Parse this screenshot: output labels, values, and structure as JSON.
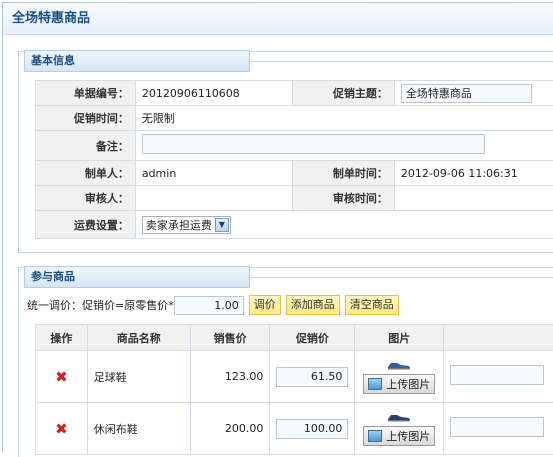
{
  "page": {
    "title": "全场特惠商品"
  },
  "basic_info": {
    "header": "基本信息",
    "order_no_label": "单据编号：",
    "order_no": "20120906110608",
    "theme_label": "促销主题：",
    "theme": "全场特惠商品",
    "promo_time_label": "促销时间：",
    "promo_time": "无限制",
    "remark_label": "备注：",
    "remark": "",
    "creator_label": "制单人：",
    "creator": "admin",
    "create_time_label": "制单时间：",
    "create_time": "2012-09-06 11:06:31",
    "reviewer_label": "审核人：",
    "reviewer": "",
    "review_time_label": "审核时间：",
    "review_time": "",
    "shipping_label": "运费设置：",
    "shipping_value": "卖家承担运费"
  },
  "goods": {
    "header": "参与商品",
    "unify_label": "统一调价：促销价=原零售价*",
    "unify_value": "1.00",
    "adjust_button": "调价",
    "add_button": "添加商品",
    "clear_button": "清空商品",
    "columns": [
      "操作",
      "商品名称",
      "销售价",
      "促销价",
      "图片"
    ],
    "upload_label": "上传图片",
    "rows": [
      {
        "name": "足球鞋",
        "price": "123.00",
        "promo_price": "61.50"
      },
      {
        "name": "休闲布鞋",
        "price": "200.00",
        "promo_price": "100.00"
      }
    ]
  },
  "colors": {
    "title": "#1c4f86",
    "delete": "#d81e1e",
    "button": "#ffe98a"
  }
}
